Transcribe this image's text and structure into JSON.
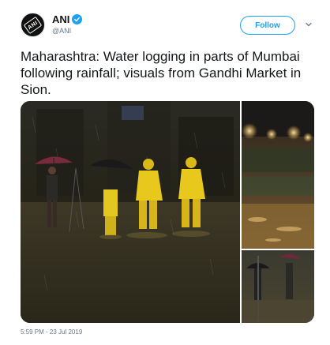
{
  "author": {
    "display_name": "ANI",
    "handle": "@ANI",
    "avatar_text": "ANI",
    "verified": true
  },
  "actions": {
    "follow_label": "Follow",
    "menu_icon": "chevron-down-icon"
  },
  "tweet": {
    "text": "Maharashtra: Water logging in parts of Mumbai following rainfall; visuals from Gandhi Market in Sion.",
    "timestamp": "5:59 PM - 23 Jul 2019"
  },
  "media": {
    "photo_count": 3
  },
  "colors": {
    "accent": "#1da1f2",
    "text": "#14171a",
    "secondary": "#657786",
    "raincoat": "#e8c21c"
  }
}
